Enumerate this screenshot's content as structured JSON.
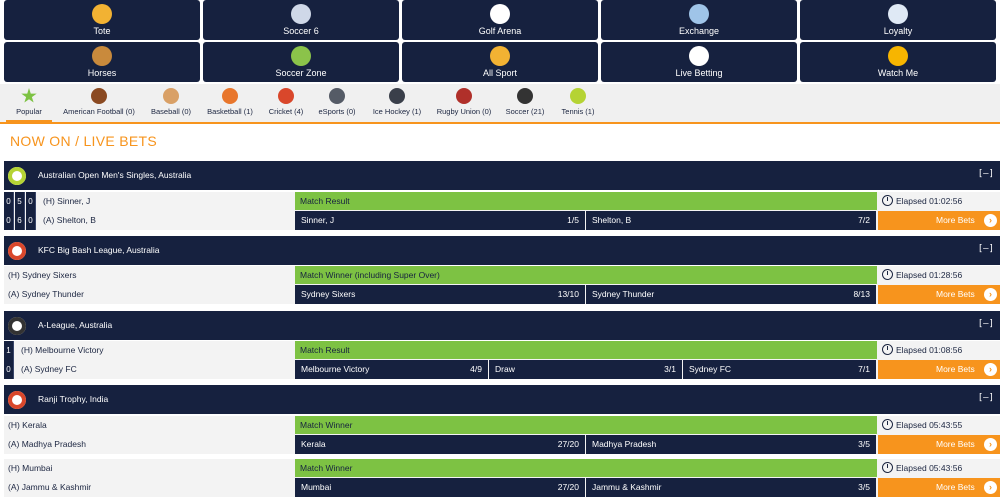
{
  "nav_tiles": [
    {
      "label": "Tote",
      "icon": "tote-icon",
      "color": "#f2b233"
    },
    {
      "label": "Soccer 6",
      "icon": "soccer6-icon",
      "color": "#cfd8e8"
    },
    {
      "label": "Golf Arena",
      "icon": "golf-ball-icon",
      "color": "#ffffff"
    },
    {
      "label": "Exchange",
      "icon": "exchange-icon",
      "color": "#9fc4e8"
    },
    {
      "label": "Loyalty",
      "icon": "diamond-icon",
      "color": "#dfe9f5"
    },
    {
      "label": "Horses",
      "icon": "horse-icon",
      "color": "#c98a3c"
    },
    {
      "label": "Soccer Zone",
      "icon": "soccer-zone-icon",
      "color": "#8bc34a"
    },
    {
      "label": "All Sport",
      "icon": "trophy-icon",
      "color": "#f2b233"
    },
    {
      "label": "Live Betting",
      "icon": "stopwatch-icon",
      "color": "#ffffff"
    },
    {
      "label": "Watch Me",
      "icon": "play-icon",
      "color": "#f7b500"
    }
  ],
  "sports": [
    {
      "label": "Popular",
      "icon": "star-icon",
      "color": "#7dc243"
    },
    {
      "label": "American Football (0)",
      "icon": "american-football-icon",
      "color": "#8b4a22"
    },
    {
      "label": "Baseball (0)",
      "icon": "baseball-bat-icon",
      "color": "#d9a066"
    },
    {
      "label": "Basketball (1)",
      "icon": "basketball-icon",
      "color": "#e8762c"
    },
    {
      "label": "Cricket (4)",
      "icon": "cricket-icon",
      "color": "#d9472b"
    },
    {
      "label": "eSports (0)",
      "icon": "gamepad-icon",
      "color": "#555b66"
    },
    {
      "label": "Ice Hockey (1)",
      "icon": "ice-hockey-icon",
      "color": "#3a3f4a"
    },
    {
      "label": "Rugby Union (0)",
      "icon": "rugby-ball-icon",
      "color": "#b0302a"
    },
    {
      "label": "Soccer (21)",
      "icon": "soccer-ball-icon",
      "color": "#333333"
    },
    {
      "label": "Tennis (1)",
      "icon": "tennis-ball-icon",
      "color": "#b5d334"
    }
  ],
  "heading": "NOW ON / LIVE BETS",
  "collapse_label": "[–]",
  "more_bets_label": "More Bets",
  "events": [
    {
      "title": "Australian Open Men's Singles, Australia",
      "icon": "tennis-ball-icon",
      "matches": [
        {
          "home": "(H) Sinner, J",
          "away": "(A) Shelton, B",
          "home_scores": [
            "0",
            "5",
            "0"
          ],
          "away_scores": [
            "0",
            "6",
            "0"
          ],
          "market": "Match Result",
          "outcomes": [
            {
              "name": "Sinner, J",
              "price": "1/5"
            },
            {
              "name": "Shelton, B",
              "price": "7/2"
            }
          ],
          "elapsed": "Elapsed 01:02:56"
        }
      ]
    },
    {
      "title": "KFC Big Bash League, Australia",
      "icon": "cricket-icon",
      "matches": [
        {
          "home": "(H) Sydney Sixers",
          "away": "(A) Sydney Thunder",
          "home_scores": [],
          "away_scores": [],
          "market": "Match Winner (including Super Over)",
          "outcomes": [
            {
              "name": "Sydney Sixers",
              "price": "13/10"
            },
            {
              "name": "Sydney Thunder",
              "price": "8/13"
            }
          ],
          "elapsed": "Elapsed 01:28:56"
        }
      ]
    },
    {
      "title": "A-League, Australia",
      "icon": "soccer-ball-icon",
      "matches": [
        {
          "home": "(H) Melbourne Victory",
          "away": "(A) Sydney FC",
          "home_scores": [
            "1"
          ],
          "away_scores": [
            "0"
          ],
          "market": "Match Result",
          "outcomes": [
            {
              "name": "Melbourne Victory",
              "price": "4/9"
            },
            {
              "name": "Draw",
              "price": "3/1"
            },
            {
              "name": "Sydney FC",
              "price": "7/1"
            }
          ],
          "elapsed": "Elapsed 01:08:56"
        }
      ]
    },
    {
      "title": "Ranji Trophy, India",
      "icon": "cricket-icon",
      "matches": [
        {
          "home": "(H) Kerala",
          "away": "(A) Madhya Pradesh",
          "home_scores": [],
          "away_scores": [],
          "market": "Match Winner",
          "outcomes": [
            {
              "name": "Kerala",
              "price": "27/20"
            },
            {
              "name": "Madhya Pradesh",
              "price": "3/5"
            }
          ],
          "elapsed": "Elapsed 05:43:55"
        },
        {
          "home": "(H) Mumbai",
          "away": "(A) Jammu & Kashmir",
          "home_scores": [],
          "away_scores": [],
          "market": "Match Winner",
          "outcomes": [
            {
              "name": "Mumbai",
              "price": "27/20"
            },
            {
              "name": "Jammu & Kashmir",
              "price": "3/5"
            }
          ],
          "elapsed": "Elapsed 05:43:56"
        }
      ]
    }
  ],
  "colors": {
    "navy": "#16213f",
    "green": "#7dc243",
    "orange": "#f7941d"
  }
}
